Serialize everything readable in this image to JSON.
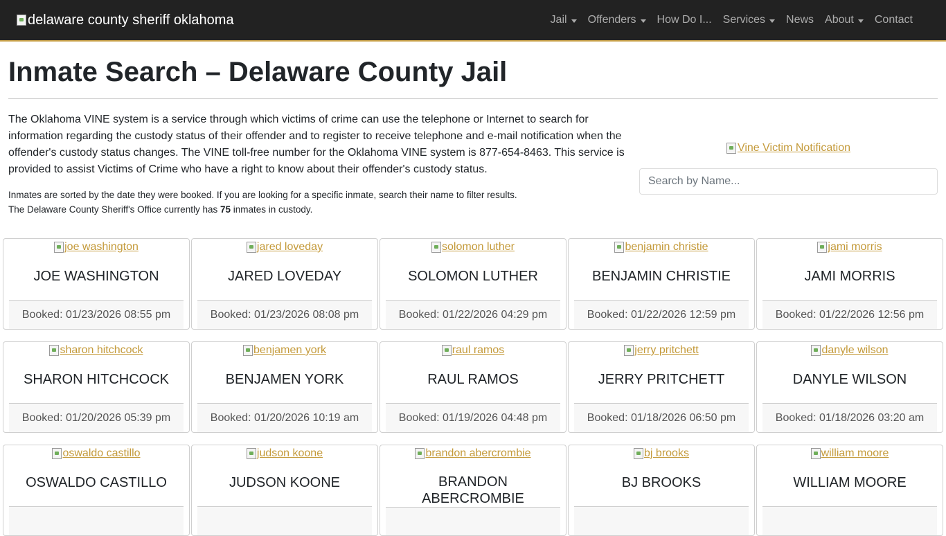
{
  "nav": {
    "brand_alt": "delaware county sheriff oklahoma",
    "links": [
      {
        "label": "Jail",
        "dropdown": true
      },
      {
        "label": "Offenders",
        "dropdown": true
      },
      {
        "label": "How Do I...",
        "dropdown": false
      },
      {
        "label": "Services",
        "dropdown": true
      },
      {
        "label": "News",
        "dropdown": false
      },
      {
        "label": "About",
        "dropdown": true
      },
      {
        "label": "Contact",
        "dropdown": false
      }
    ]
  },
  "page": {
    "title": "Inmate Search – Delaware County Jail",
    "intro": "The Oklahoma VINE system is a service through which victims of crime can use the telephone or Internet to search for information regarding the custody status of their offender and to register to receive telephone and e-mail notification when the offender's custody status changes. The VINE toll-free number for the Oklahoma VINE system is 877-654-8463. This service is provided to assist Victims of Crime who have a right to know about their offender's custody status.",
    "sorted_note": "Inmates are sorted by the date they were booked. If you are looking for a specific inmate, search their name to filter results.",
    "count_prefix": "The Delaware County Sheriff's Office currently has",
    "count": "75",
    "count_suffix": "inmates in custody.",
    "vine_alt": "Vine Victim Notification",
    "search_placeholder": "Search by Name..."
  },
  "inmates": [
    {
      "img_alt": "joe washington",
      "name": "JOE WASHINGTON",
      "booked": "Booked: 01/23/2026 08:55 pm"
    },
    {
      "img_alt": "jared loveday",
      "name": "JARED LOVEDAY",
      "booked": "Booked: 01/23/2026 08:08 pm"
    },
    {
      "img_alt": "solomon luther",
      "name": "SOLOMON LUTHER",
      "booked": "Booked: 01/22/2026 04:29 pm"
    },
    {
      "img_alt": "benjamin christie",
      "name": "BENJAMIN CHRISTIE",
      "booked": "Booked: 01/22/2026 12:59 pm"
    },
    {
      "img_alt": "jami morris",
      "name": "JAMI MORRIS",
      "booked": "Booked: 01/22/2026 12:56 pm"
    },
    {
      "img_alt": "sharon hitchcock",
      "name": "SHARON HITCHCOCK",
      "booked": "Booked: 01/20/2026 05:39 pm"
    },
    {
      "img_alt": "benjamen york",
      "name": "BENJAMEN YORK",
      "booked": "Booked: 01/20/2026 10:19 am"
    },
    {
      "img_alt": "raul ramos",
      "name": "RAUL RAMOS",
      "booked": "Booked: 01/19/2026 04:48 pm"
    },
    {
      "img_alt": "jerry pritchett",
      "name": "JERRY PRITCHETT",
      "booked": "Booked: 01/18/2026 06:50 pm"
    },
    {
      "img_alt": "danyle wilson",
      "name": "DANYLE WILSON",
      "booked": "Booked: 01/18/2026 03:20 am"
    },
    {
      "img_alt": "oswaldo castillo",
      "name": "OSWALDO CASTILLO",
      "booked": ""
    },
    {
      "img_alt": "judson koone",
      "name": "JUDSON KOONE",
      "booked": ""
    },
    {
      "img_alt": "brandon abercrombie",
      "name": "BRANDON ABERCROMBIE",
      "booked": ""
    },
    {
      "img_alt": "bj brooks",
      "name": "BJ BROOKS",
      "booked": ""
    },
    {
      "img_alt": "william moore",
      "name": "WILLIAM MOORE",
      "booked": ""
    }
  ],
  "colors": {
    "navbar_bg": "#222222",
    "navbar_border": "#c9a24a",
    "link": "#c49a3a"
  }
}
